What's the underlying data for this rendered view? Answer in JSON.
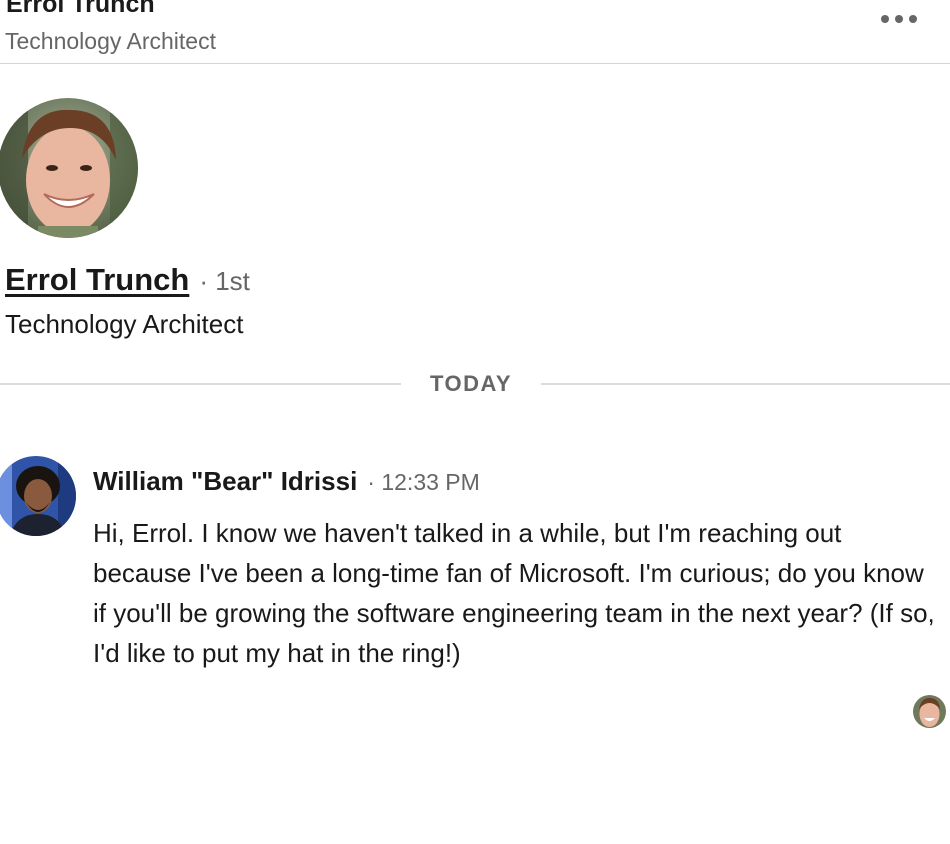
{
  "header": {
    "name": "Errol Trunch",
    "headline": "Technology Architect",
    "more_icon": "more-horizontal-icon"
  },
  "profile": {
    "name": "Errol Trunch",
    "degree": "· 1st",
    "headline": "Technology Architect",
    "avatar_alt": "profile-photo"
  },
  "divider": {
    "label": "TODAY"
  },
  "message": {
    "sender": "William \"Bear\" Idrissi",
    "time": "· 12:33 PM",
    "body": "Hi, Errol. I know we haven't talked in a while, but I'm reaching out because I've been a long-time fan of Microsoft. I'm curious; do you know if you'll be growing the software engineering team in the next year? (If so, I'd like to put my hat in the ring!)"
  },
  "colors": {
    "text_primary": "#191919",
    "text_secondary": "#666666",
    "divider": "#dcdcdc",
    "header_border": "#e3cfc7"
  }
}
